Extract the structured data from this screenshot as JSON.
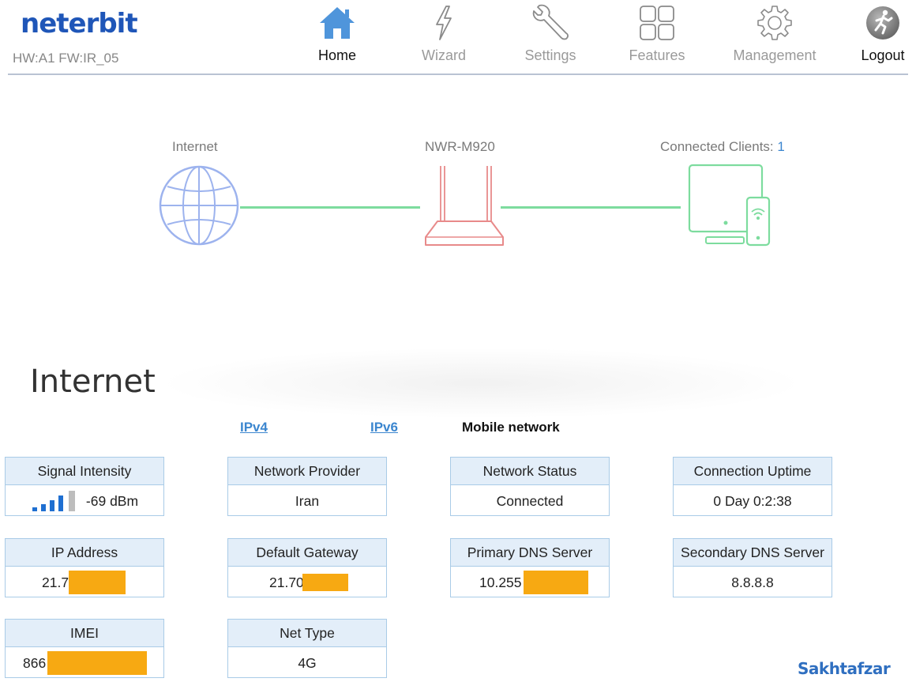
{
  "brand": {
    "logo_text": "neterbit",
    "hw_fw": "HW:A1 FW:IR_05"
  },
  "nav": {
    "home": "Home",
    "wizard": "Wizard",
    "settings": "Settings",
    "features": "Features",
    "management": "Management",
    "logout": "Logout",
    "active": "Home"
  },
  "topology": {
    "internet_label": "Internet",
    "device_label": "NWR-M920",
    "clients_label": "Connected Clients:",
    "clients_count": "1"
  },
  "internet": {
    "title": "Internet",
    "tabs": {
      "ipv4": "IPv4",
      "ipv6": "IPv6",
      "mobile": "Mobile network",
      "selected": "Mobile network"
    },
    "signal_bars_filled": 4,
    "signal_bars_total": 5,
    "cards": {
      "signal_intensity": {
        "label": "Signal Intensity",
        "value": "-69 dBm"
      },
      "network_provider": {
        "label": "Network Provider",
        "value": "Iran"
      },
      "network_status": {
        "label": "Network Status",
        "value": "Connected"
      },
      "connection_uptime": {
        "label": "Connection Uptime",
        "value": "0 Day 0:2:38"
      },
      "ip_address": {
        "label": "IP Address",
        "value": "21.7("
      },
      "default_gateway": {
        "label": "Default Gateway",
        "value": "21.70"
      },
      "primary_dns": {
        "label": "Primary DNS Server",
        "value": "10.255"
      },
      "secondary_dns": {
        "label": "Secondary DNS Server",
        "value": "8.8.8.8"
      },
      "imei": {
        "label": "IMEI",
        "value": "866"
      },
      "net_type": {
        "label": "Net Type",
        "value": "4G"
      }
    }
  },
  "watermark": "Sakhtafzar",
  "colors": {
    "brand_blue": "#1f56b8",
    "link_blue": "#3b86cf",
    "card_border": "#a9cbe7",
    "card_header_bg": "#e3eef9",
    "redaction_orange": "#f7a912",
    "link_green": "#7ddc9e",
    "router_red": "#e88a8a",
    "globe_blue": "#9db3ee"
  }
}
